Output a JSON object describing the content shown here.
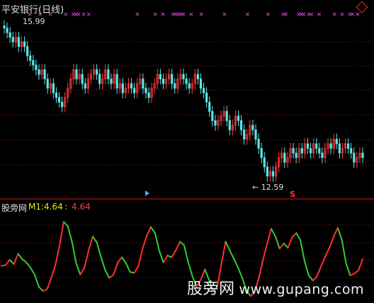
{
  "chart_title": "平安银行(日线)",
  "indicator": {
    "name": "股旁网",
    "m1_label": "M1:",
    "m1_value": "4.64",
    "sep": ":",
    "m1_value2": "4.64"
  },
  "annotations": {
    "high": "15.99",
    "low": "12.59"
  },
  "watermark": {
    "cn": "股旁网",
    "url": "www.gupang.com"
  },
  "colors": {
    "up": "#ff3b3b",
    "down": "#5ae6e6",
    "grid": "#9b1c1c",
    "marker": "#ff44ff",
    "line_up": "#ff3030",
    "line_down": "#33cc33"
  },
  "chart_data": [
    {
      "type": "candlestick",
      "title": "平安银行(日线)",
      "high_annotation": 15.99,
      "low_annotation": 12.59,
      "ylim": [
        12.3,
        16.2
      ],
      "close": [
        15.9,
        15.8,
        15.7,
        15.6,
        15.7,
        15.5,
        15.6,
        15.5,
        15.3,
        15.2,
        15.1,
        15.0,
        14.9,
        15.0,
        14.8,
        14.6,
        14.7,
        14.5,
        14.4,
        14.3,
        14.2,
        14.4,
        14.6,
        14.8,
        15.0,
        14.8,
        14.9,
        14.7,
        14.6,
        14.8,
        14.9,
        15.0,
        14.9,
        14.7,
        14.8,
        15.0,
        14.8,
        14.7,
        14.9,
        14.6,
        14.7,
        14.5,
        14.6,
        14.7,
        14.6,
        14.5,
        14.7,
        14.8,
        14.6,
        14.5,
        14.4,
        14.6,
        14.7,
        14.9,
        14.8,
        14.7,
        14.8,
        14.9,
        14.7,
        14.6,
        14.8,
        14.9,
        14.8,
        14.7,
        14.6,
        14.7,
        14.9,
        14.8,
        14.6,
        14.5,
        14.3,
        14.1,
        13.9,
        13.8,
        13.9,
        14.0,
        14.1,
        13.9,
        13.7,
        13.8,
        14.0,
        13.9,
        13.7,
        13.5,
        13.6,
        13.8,
        13.7,
        13.5,
        13.3,
        13.1,
        12.9,
        12.7,
        12.8,
        12.7,
        12.9,
        13.1,
        13.2,
        13.0,
        13.1,
        13.3,
        13.2,
        13.1,
        13.3,
        13.2,
        13.4,
        13.3,
        13.2,
        13.4,
        13.3,
        13.2,
        13.1,
        13.3,
        13.4,
        13.3,
        13.5,
        13.4,
        13.2,
        13.3,
        13.4,
        13.3,
        13.2,
        13.0,
        13.1,
        13.2,
        13.1
      ],
      "top_markers": [
        10,
        14,
        18,
        24,
        27,
        28,
        29,
        31,
        33,
        52,
        59,
        62,
        66,
        67,
        68,
        69,
        70,
        73,
        77,
        86,
        95,
        103,
        109,
        110,
        115,
        116,
        117,
        119,
        120,
        123,
        129,
        132,
        135,
        136,
        138
      ]
    },
    {
      "type": "line",
      "series": [
        {
          "name": "M1",
          "last_value": 4.64
        }
      ],
      "values": [
        3.8,
        3.9,
        4.5,
        4.0,
        5.2,
        4.6,
        4.2,
        3.6,
        2.8,
        1.4,
        0.9,
        1.1,
        2.4,
        3.9,
        6.2,
        8.9,
        8.4,
        6.6,
        4.1,
        2.8,
        3.6,
        5.6,
        7.2,
        6.5,
        4.8,
        3.3,
        2.4,
        2.8,
        4.2,
        4.8,
        4.1,
        3.1,
        3.0,
        3.8,
        5.8,
        7.3,
        8.3,
        7.6,
        5.6,
        4.2,
        5.0,
        4.8,
        5.6,
        6.6,
        6.2,
        4.2,
        2.6,
        1.4,
        2.2,
        3.4,
        2.2,
        0.9,
        1.4,
        4.1,
        6.6,
        5.6,
        4.6,
        3.6,
        2.4,
        1.0,
        0.3,
        0.8,
        2.4,
        4.5,
        6.4,
        8.1,
        7.2,
        5.8,
        6.4,
        5.9,
        7.1,
        7.6,
        6.8,
        4.4,
        2.7,
        2.1,
        2.6,
        3.8,
        4.9,
        5.9,
        7.2,
        8.2,
        6.8,
        4.1,
        2.7,
        2.9,
        3.3,
        4.6
      ]
    }
  ]
}
